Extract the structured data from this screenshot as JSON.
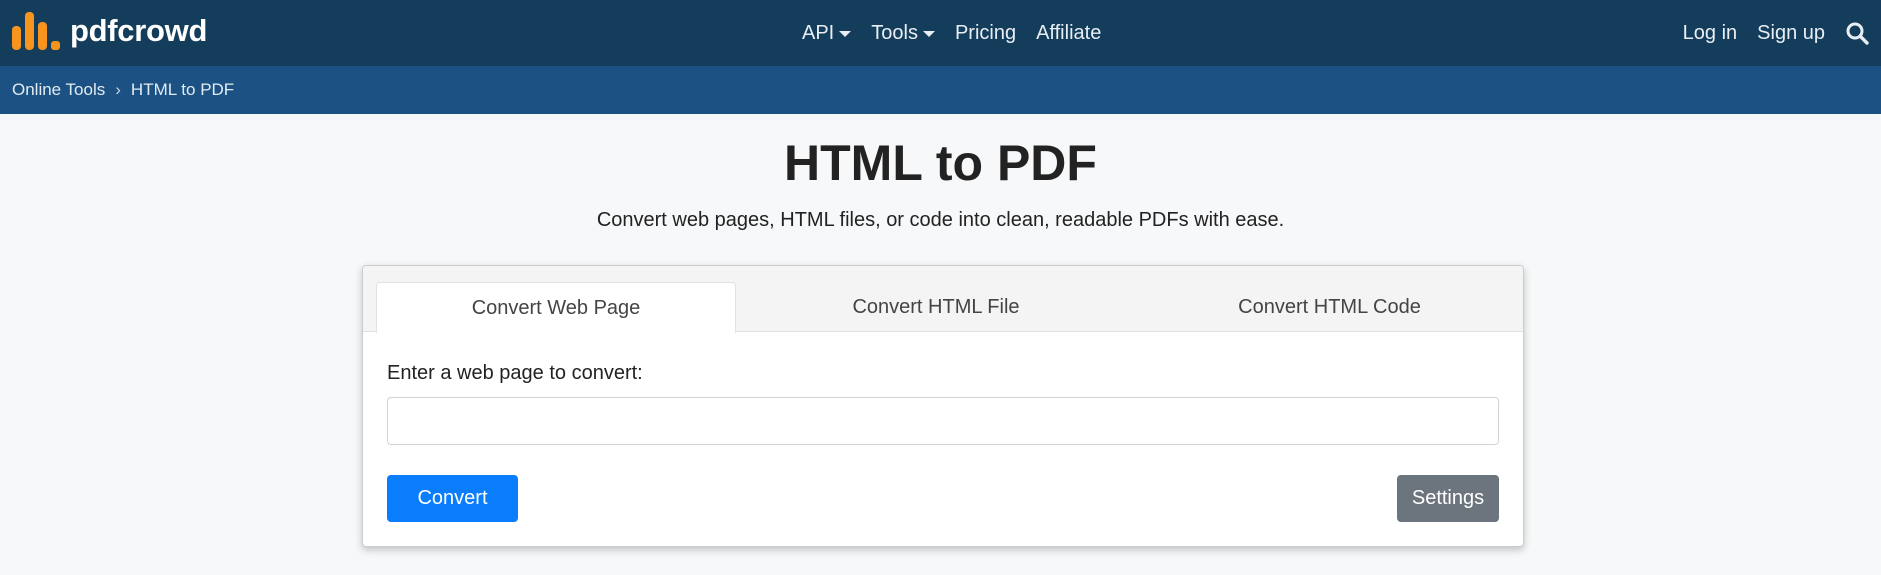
{
  "brand": {
    "name": "pdfcrowd",
    "logo_icon": "bar-chart-logo-icon",
    "logo_color": "#f7941d"
  },
  "nav": {
    "center": [
      {
        "label": "API",
        "dropdown": true
      },
      {
        "label": "Tools",
        "dropdown": true
      },
      {
        "label": "Pricing",
        "dropdown": false
      },
      {
        "label": "Affiliate",
        "dropdown": false
      }
    ],
    "login": "Log in",
    "signup": "Sign up",
    "search_icon": "search-icon"
  },
  "breadcrumb": {
    "items": [
      "Online Tools",
      "HTML to PDF"
    ],
    "separator": "›"
  },
  "page": {
    "title": "HTML to PDF",
    "subtitle": "Convert web pages, HTML files, or code into clean, readable PDFs with ease."
  },
  "converter": {
    "tabs": [
      {
        "label": "Convert Web Page",
        "active": true
      },
      {
        "label": "Convert HTML File",
        "active": false
      },
      {
        "label": "Convert HTML Code",
        "active": false
      }
    ],
    "field_label": "Enter a web page to convert:",
    "url_value": "",
    "convert_label": "Convert",
    "settings_label": "Settings"
  },
  "colors": {
    "navbar": "#143d5c",
    "breadcrumb_bar": "#1b5283",
    "primary_button": "#0a7dfc",
    "secondary_button": "#6c757d"
  }
}
